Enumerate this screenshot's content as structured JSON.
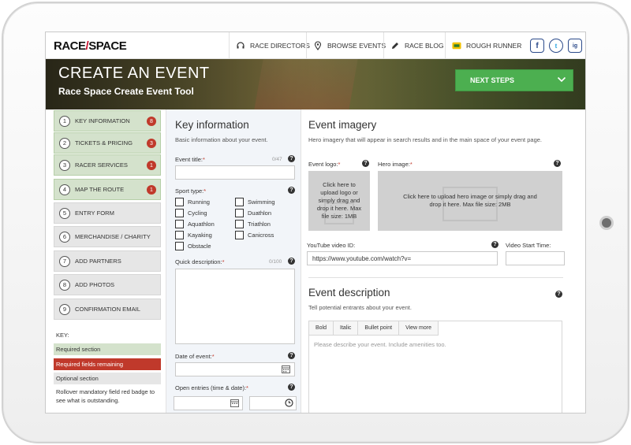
{
  "brand": {
    "logo_left": "RACE",
    "logo_slash": "/",
    "logo_right": "SPACE"
  },
  "nav": [
    {
      "label": "RACE DIRECTORS",
      "icon": "headset-icon"
    },
    {
      "label": "BROWSE EVENTS",
      "icon": "location-pin-icon"
    },
    {
      "label": "RACE BLOG",
      "icon": "pencil-icon"
    },
    {
      "label": "ROUGH RUNNER",
      "icon": "rough-runner-logo-icon"
    }
  ],
  "social": [
    "f",
    "t",
    "ig"
  ],
  "hero": {
    "title": "CREATE AN EVENT",
    "subtitle": "Race Space Create Event Tool",
    "next_button": "NEXT STEPS"
  },
  "steps": [
    {
      "num": "1",
      "label": "KEY INFORMATION",
      "badge": "8",
      "active": true
    },
    {
      "num": "2",
      "label": "TICKETS & PRICING",
      "badge": "3"
    },
    {
      "num": "3",
      "label": "RACER SERVICES",
      "badge": "1"
    },
    {
      "num": "4",
      "label": "MAP THE ROUTE",
      "badge": "1"
    },
    {
      "num": "5",
      "label": "ENTRY FORM"
    },
    {
      "num": "6",
      "label": "MERCHANDISE / CHARITY"
    },
    {
      "num": "7",
      "label": "ADD PARTNERS"
    },
    {
      "num": "8",
      "label": "ADD PHOTOS"
    },
    {
      "num": "9",
      "label": "CONFIRMATION EMAIL"
    }
  ],
  "key": {
    "heading": "KEY:",
    "required_section": "Required section",
    "required_fields": "Required fields remaining",
    "optional_section": "Optional section",
    "rollover": "Rollover mandatory field red badge to see what is outstanding."
  },
  "key_info": {
    "title": "Key information",
    "subtitle": "Basic information about your event.",
    "event_title_label": "Event title:",
    "event_title_counter": "0/47",
    "sport_type_label": "Sport type:",
    "sports": [
      "Running",
      "Swimming",
      "Cycling",
      "Duathlon",
      "Aquathlon",
      "Triathlon",
      "Kayaking",
      "Canicross",
      "Obstacle"
    ],
    "quick_desc_label": "Quick description:",
    "quick_desc_counter": "0/100",
    "date_label": "Date of event:",
    "open_entries_label": "Open entries (time & date):",
    "required_mark": "*"
  },
  "imagery": {
    "title": "Event imagery",
    "subtitle": "Hero imagery that will appear in search results and in the main space of your event page.",
    "logo_label": "Event logo:",
    "hero_label": "Hero image:",
    "logo_drop": "Click here to upload logo or simply drag and drop it here. Max file size: 1MB",
    "hero_drop": "Click here to upload hero image or simply drag and drop it here. Max file size: 2MB",
    "youtube_label": "YouTube video ID:",
    "youtube_value": "https://www.youtube.com/watch?v=",
    "start_time_label": "Video Start Time:"
  },
  "description": {
    "title": "Event description",
    "subtitle": "Tell potential entrants about your event.",
    "tools": [
      "Bold",
      "Italic",
      "Bullet point",
      "View more"
    ],
    "placeholder": "Please describe your event. Include amenities too."
  },
  "colors": {
    "accent_green": "#4caf50",
    "required_red": "#c0392b",
    "required_section_green": "#d4e2cc"
  }
}
